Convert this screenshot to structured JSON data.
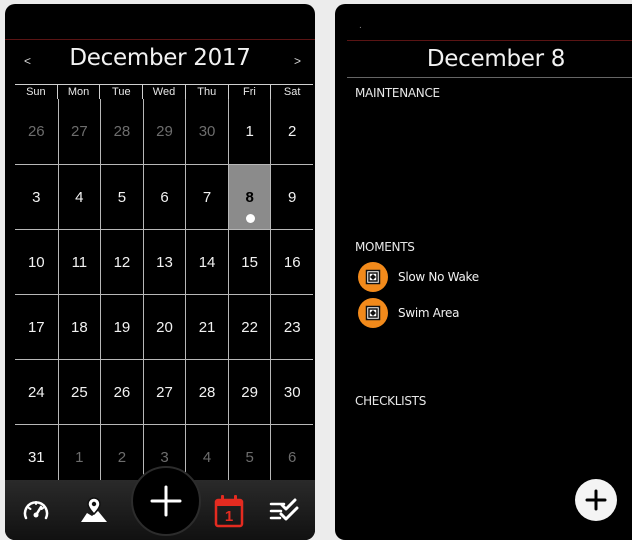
{
  "calendar": {
    "month_title": "December 2017",
    "prev_label": "<",
    "next_label": ">",
    "weekdays": [
      "Sun",
      "Mon",
      "Tue",
      "Wed",
      "Thu",
      "Fri",
      "Sat"
    ],
    "weeks": [
      [
        {
          "d": "26",
          "other": true
        },
        {
          "d": "27",
          "other": true
        },
        {
          "d": "28",
          "other": true
        },
        {
          "d": "29",
          "other": true
        },
        {
          "d": "30",
          "other": true
        },
        {
          "d": "1"
        },
        {
          "d": "2"
        }
      ],
      [
        {
          "d": "3"
        },
        {
          "d": "4"
        },
        {
          "d": "5"
        },
        {
          "d": "6"
        },
        {
          "d": "7"
        },
        {
          "d": "8",
          "selected": true,
          "event": true
        },
        {
          "d": "9"
        }
      ],
      [
        {
          "d": "10"
        },
        {
          "d": "11"
        },
        {
          "d": "12"
        },
        {
          "d": "13"
        },
        {
          "d": "14"
        },
        {
          "d": "15"
        },
        {
          "d": "16"
        }
      ],
      [
        {
          "d": "17"
        },
        {
          "d": "18"
        },
        {
          "d": "19"
        },
        {
          "d": "20"
        },
        {
          "d": "21"
        },
        {
          "d": "22"
        },
        {
          "d": "23"
        }
      ],
      [
        {
          "d": "24"
        },
        {
          "d": "25"
        },
        {
          "d": "26"
        },
        {
          "d": "27"
        },
        {
          "d": "28"
        },
        {
          "d": "29"
        },
        {
          "d": "30"
        }
      ],
      [
        {
          "d": "31"
        },
        {
          "d": "1",
          "other": true
        },
        {
          "d": "2",
          "other": true
        },
        {
          "d": "3",
          "other": true
        },
        {
          "d": "4",
          "other": true
        },
        {
          "d": "5",
          "other": true
        },
        {
          "d": "6",
          "other": true
        }
      ]
    ]
  },
  "tabbar": {
    "icons": [
      "gauge-icon",
      "map-pin-icon",
      "plus-icon",
      "calendar-icon",
      "checklist-icon"
    ],
    "calendar_day": "1",
    "active_color": "#e42b20"
  },
  "day_detail": {
    "title": "December 8",
    "top_marker": ".",
    "maintenance_label": "MAINTENANCE",
    "moments_label": "MOMENTS",
    "moments": [
      {
        "label": "Slow No Wake",
        "icon": "moment-icon"
      },
      {
        "label": "Swim Area",
        "icon": "moment-icon"
      }
    ],
    "checklists_label": "CHECKLISTS",
    "accent_color": "#f28a1b"
  }
}
